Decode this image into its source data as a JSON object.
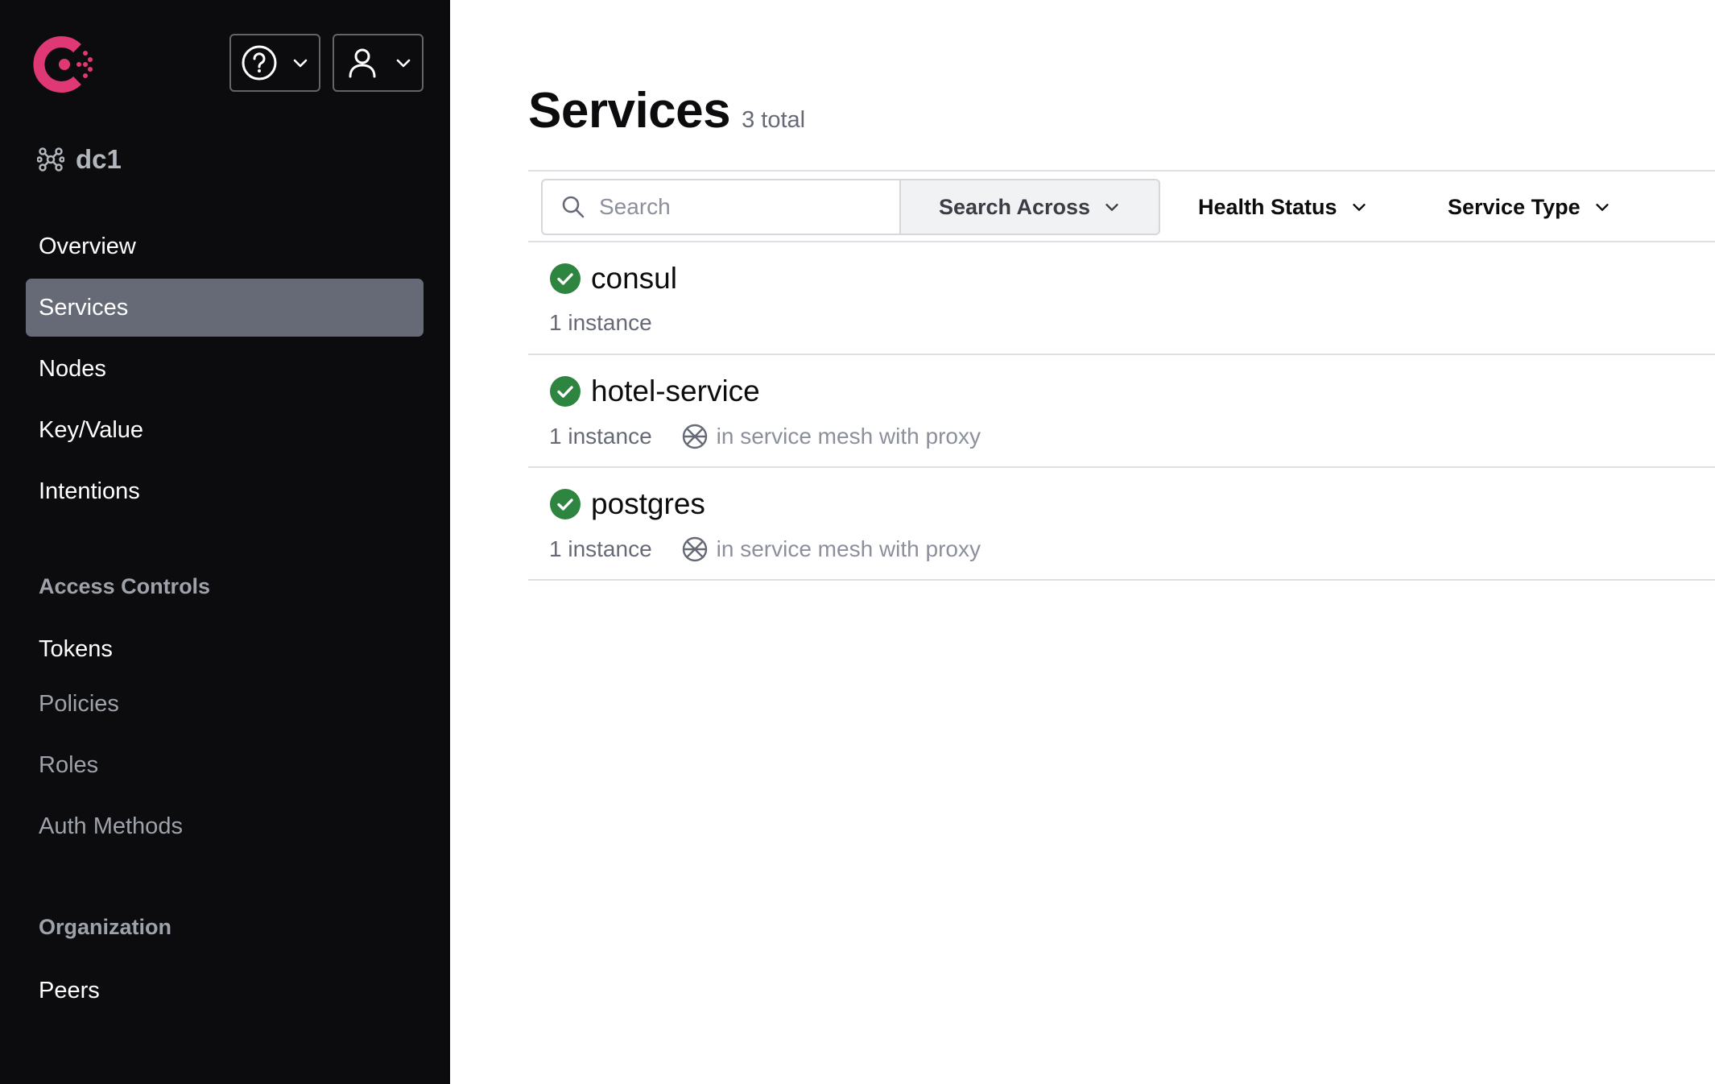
{
  "header": {
    "help_label": "Help",
    "user_label": "User"
  },
  "sidebar": {
    "datacenter": "dc1",
    "nav": [
      {
        "label": "Overview"
      },
      {
        "label": "Services",
        "active": true
      },
      {
        "label": "Nodes"
      },
      {
        "label": "Key/Value"
      },
      {
        "label": "Intentions"
      }
    ],
    "access_controls": {
      "heading": "Access Controls",
      "items": [
        {
          "label": "Tokens"
        },
        {
          "label": "Policies"
        },
        {
          "label": "Roles"
        },
        {
          "label": "Auth Methods"
        }
      ]
    },
    "organization": {
      "heading": "Organization",
      "items": [
        {
          "label": "Peers"
        }
      ]
    }
  },
  "main": {
    "title": "Services",
    "count": "3 total",
    "filters": {
      "search_placeholder": "Search",
      "search_value": "",
      "search_across": "Search Across",
      "health_status": "Health Status",
      "service_type": "Service Type"
    },
    "services": [
      {
        "name": "consul",
        "instances": "1 instance",
        "mesh": ""
      },
      {
        "name": "hotel-service",
        "instances": "1 instance",
        "mesh": "in service mesh with proxy"
      },
      {
        "name": "postgres",
        "instances": "1 instance",
        "mesh": "in service mesh with proxy"
      }
    ]
  },
  "icons": {
    "logo": "consul-logo",
    "help": "help-circle-icon",
    "user": "user-icon",
    "datacenter": "datacenter-icon",
    "search": "search-icon",
    "health_ok": "check-circle-icon",
    "mesh": "mesh-icon",
    "chevron": "chevron-down-icon"
  },
  "colors": {
    "sidebar_bg": "#0c0c0e",
    "active_nav": "#656a76",
    "brand": "#e03875",
    "health_passing": "#2e8540"
  }
}
